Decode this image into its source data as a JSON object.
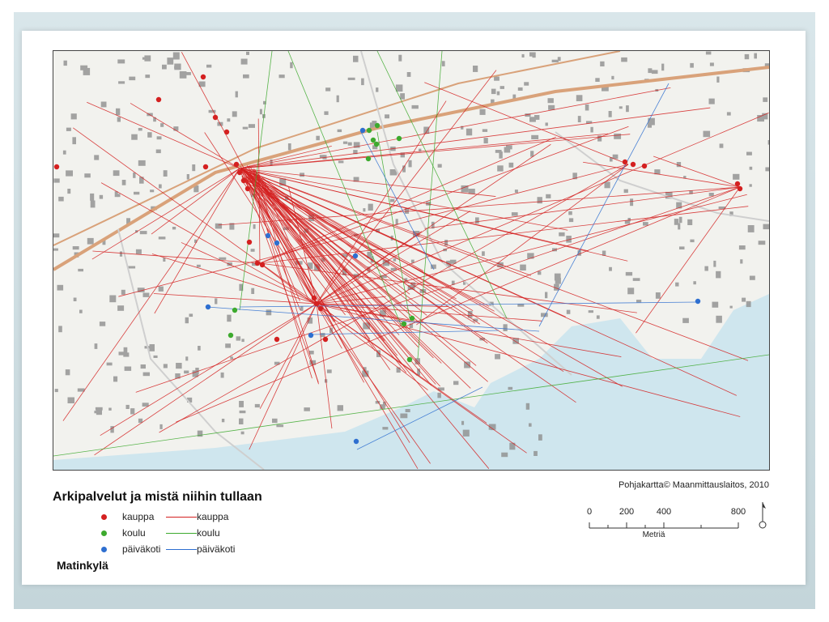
{
  "map": {
    "credit": "Pohjakartta© Maanmittauslaitos,  2010",
    "colors": {
      "kauppa": "#d42020",
      "koulu": "#3daa2e",
      "paivakoti": "#2e6fd0",
      "water": "#cfe6ee",
      "land": "#f2f2ee",
      "building": "#8c8c8c",
      "road": "#d9a27a"
    }
  },
  "legend": {
    "title": "Arkipalvelut ja mistä niihin tullaan",
    "area_name": "Matinkylä",
    "items": [
      {
        "point_label": "kauppa",
        "line_label": "kauppa",
        "color": "#d42020"
      },
      {
        "point_label": "koulu",
        "line_label": "koulu",
        "color": "#3daa2e"
      },
      {
        "point_label": "päiväkoti",
        "line_label": "päiväkoti",
        "color": "#2e6fd0"
      }
    ]
  },
  "scale": {
    "ticks": [
      "0",
      "200",
      "400",
      "800"
    ],
    "unit": "Metriä"
  }
}
